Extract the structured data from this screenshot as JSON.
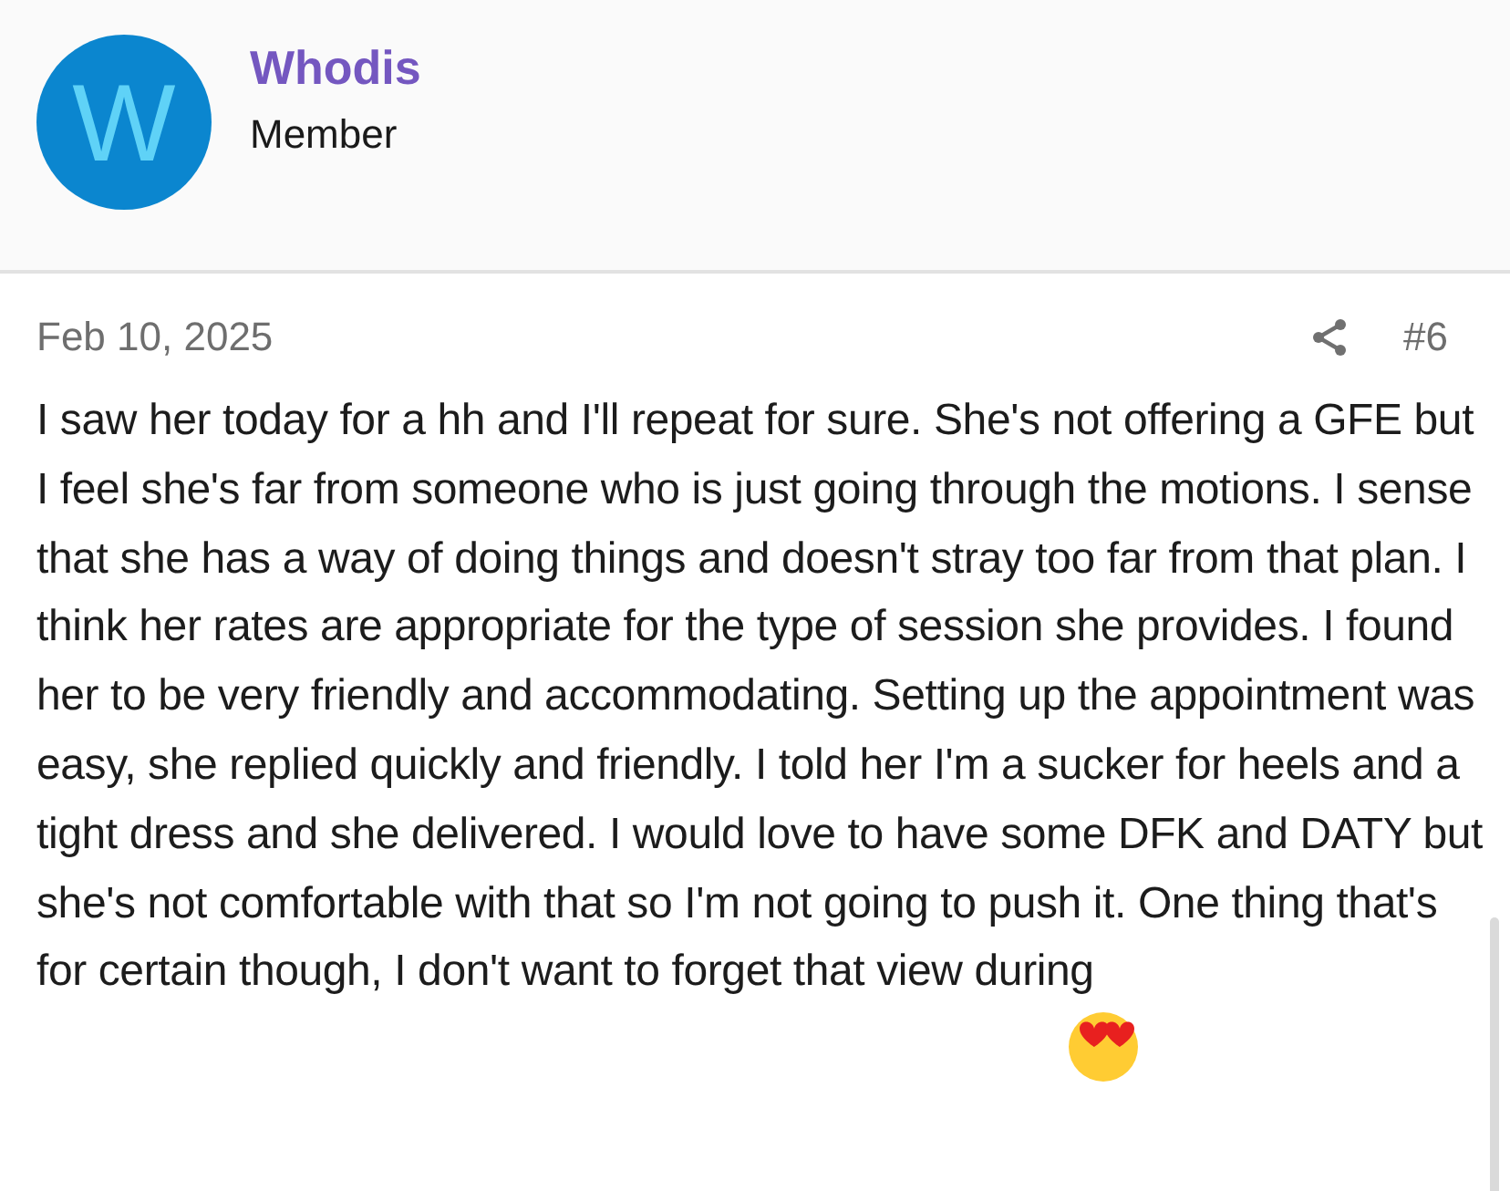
{
  "author": {
    "avatar_letter": "W",
    "name": "Whodis",
    "role": "Member"
  },
  "post": {
    "date": "Feb 10, 2025",
    "number": "#6",
    "body": "I saw her today for a hh and I'll repeat for sure. She's not offering a GFE but I feel she's far from someone who is just going through the motions. I sense that she has a way of doing things and doesn't stray too far from that plan. I think her rates are appropriate for the type of session she provides. I found her to be very friendly and accommodating. Setting up the appointment was easy, she replied quickly and friendly. I told her I'm a sucker for heels and a tight dress and she delivered. I would love to have some DFK and DATY but she's not comfortable with that so I'm not going to push it. One thing that's for certain though, I don't want to forget that view during"
  }
}
